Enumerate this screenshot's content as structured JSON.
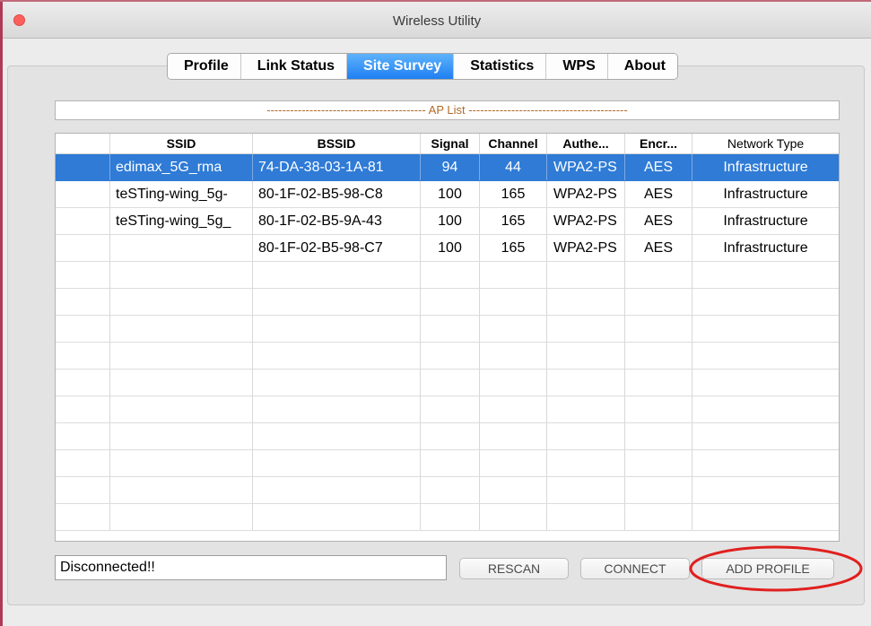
{
  "window": {
    "title": "Wireless Utility"
  },
  "tabs": [
    {
      "label": "Profile",
      "active": false
    },
    {
      "label": "Link Status",
      "active": false
    },
    {
      "label": "Site Survey",
      "active": true
    },
    {
      "label": "Statistics",
      "active": false
    },
    {
      "label": "WPS",
      "active": false
    },
    {
      "label": "About",
      "active": false
    }
  ],
  "ap_list": {
    "title": "----------------------------------------- AP List -----------------------------------------",
    "columns": [
      "",
      "SSID",
      "BSSID",
      "Signal",
      "Channel",
      "Authe...",
      "Encr...",
      "Network Type"
    ],
    "rows": [
      {
        "selected": true,
        "ssid": "edimax_5G_rma",
        "bssid": "74-DA-38-03-1A-81",
        "signal": "94",
        "channel": "44",
        "auth": "WPA2-PS",
        "encr": "AES",
        "network_type": "Infrastructure"
      },
      {
        "selected": false,
        "ssid": "teSTing-wing_5g-",
        "bssid": "80-1F-02-B5-98-C8",
        "signal": "100",
        "channel": "165",
        "auth": "WPA2-PS",
        "encr": "AES",
        "network_type": "Infrastructure"
      },
      {
        "selected": false,
        "ssid": "teSTing-wing_5g_",
        "bssid": "80-1F-02-B5-9A-43",
        "signal": "100",
        "channel": "165",
        "auth": "WPA2-PS",
        "encr": "AES",
        "network_type": "Infrastructure"
      },
      {
        "selected": false,
        "ssid": "",
        "bssid": "80-1F-02-B5-98-C7",
        "signal": "100",
        "channel": "165",
        "auth": "WPA2-PS",
        "encr": "AES",
        "network_type": "Infrastructure"
      }
    ]
  },
  "status": {
    "text": "Disconnected!!"
  },
  "buttons": {
    "rescan": "RESCAN",
    "connect": "CONNECT",
    "add_profile": "ADD PROFILE"
  },
  "colors": {
    "selection": "#2f7bd6",
    "active_tab": "#1e7ff3",
    "annotation": "#e0201f",
    "close_button": "#fc605c"
  }
}
